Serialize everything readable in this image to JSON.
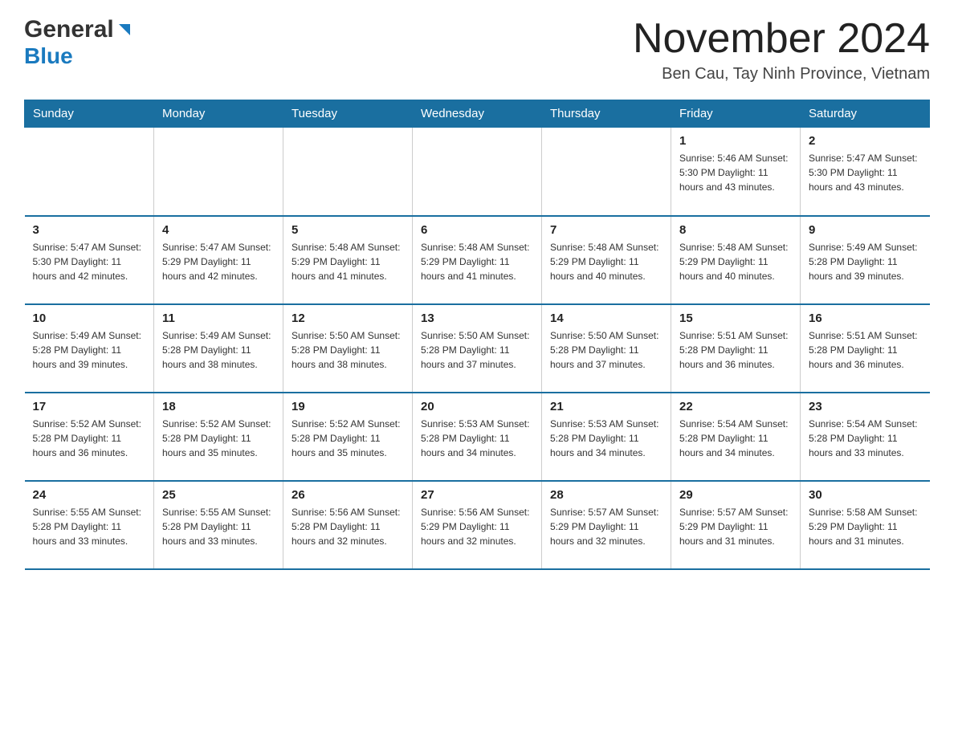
{
  "header": {
    "logo_general": "General",
    "logo_blue": "Blue",
    "month_title": "November 2024",
    "location": "Ben Cau, Tay Ninh Province, Vietnam"
  },
  "weekdays": [
    "Sunday",
    "Monday",
    "Tuesday",
    "Wednesday",
    "Thursday",
    "Friday",
    "Saturday"
  ],
  "weeks": [
    [
      {
        "day": "",
        "info": ""
      },
      {
        "day": "",
        "info": ""
      },
      {
        "day": "",
        "info": ""
      },
      {
        "day": "",
        "info": ""
      },
      {
        "day": "",
        "info": ""
      },
      {
        "day": "1",
        "info": "Sunrise: 5:46 AM\nSunset: 5:30 PM\nDaylight: 11 hours and 43 minutes."
      },
      {
        "day": "2",
        "info": "Sunrise: 5:47 AM\nSunset: 5:30 PM\nDaylight: 11 hours and 43 minutes."
      }
    ],
    [
      {
        "day": "3",
        "info": "Sunrise: 5:47 AM\nSunset: 5:30 PM\nDaylight: 11 hours and 42 minutes."
      },
      {
        "day": "4",
        "info": "Sunrise: 5:47 AM\nSunset: 5:29 PM\nDaylight: 11 hours and 42 minutes."
      },
      {
        "day": "5",
        "info": "Sunrise: 5:48 AM\nSunset: 5:29 PM\nDaylight: 11 hours and 41 minutes."
      },
      {
        "day": "6",
        "info": "Sunrise: 5:48 AM\nSunset: 5:29 PM\nDaylight: 11 hours and 41 minutes."
      },
      {
        "day": "7",
        "info": "Sunrise: 5:48 AM\nSunset: 5:29 PM\nDaylight: 11 hours and 40 minutes."
      },
      {
        "day": "8",
        "info": "Sunrise: 5:48 AM\nSunset: 5:29 PM\nDaylight: 11 hours and 40 minutes."
      },
      {
        "day": "9",
        "info": "Sunrise: 5:49 AM\nSunset: 5:28 PM\nDaylight: 11 hours and 39 minutes."
      }
    ],
    [
      {
        "day": "10",
        "info": "Sunrise: 5:49 AM\nSunset: 5:28 PM\nDaylight: 11 hours and 39 minutes."
      },
      {
        "day": "11",
        "info": "Sunrise: 5:49 AM\nSunset: 5:28 PM\nDaylight: 11 hours and 38 minutes."
      },
      {
        "day": "12",
        "info": "Sunrise: 5:50 AM\nSunset: 5:28 PM\nDaylight: 11 hours and 38 minutes."
      },
      {
        "day": "13",
        "info": "Sunrise: 5:50 AM\nSunset: 5:28 PM\nDaylight: 11 hours and 37 minutes."
      },
      {
        "day": "14",
        "info": "Sunrise: 5:50 AM\nSunset: 5:28 PM\nDaylight: 11 hours and 37 minutes."
      },
      {
        "day": "15",
        "info": "Sunrise: 5:51 AM\nSunset: 5:28 PM\nDaylight: 11 hours and 36 minutes."
      },
      {
        "day": "16",
        "info": "Sunrise: 5:51 AM\nSunset: 5:28 PM\nDaylight: 11 hours and 36 minutes."
      }
    ],
    [
      {
        "day": "17",
        "info": "Sunrise: 5:52 AM\nSunset: 5:28 PM\nDaylight: 11 hours and 36 minutes."
      },
      {
        "day": "18",
        "info": "Sunrise: 5:52 AM\nSunset: 5:28 PM\nDaylight: 11 hours and 35 minutes."
      },
      {
        "day": "19",
        "info": "Sunrise: 5:52 AM\nSunset: 5:28 PM\nDaylight: 11 hours and 35 minutes."
      },
      {
        "day": "20",
        "info": "Sunrise: 5:53 AM\nSunset: 5:28 PM\nDaylight: 11 hours and 34 minutes."
      },
      {
        "day": "21",
        "info": "Sunrise: 5:53 AM\nSunset: 5:28 PM\nDaylight: 11 hours and 34 minutes."
      },
      {
        "day": "22",
        "info": "Sunrise: 5:54 AM\nSunset: 5:28 PM\nDaylight: 11 hours and 34 minutes."
      },
      {
        "day": "23",
        "info": "Sunrise: 5:54 AM\nSunset: 5:28 PM\nDaylight: 11 hours and 33 minutes."
      }
    ],
    [
      {
        "day": "24",
        "info": "Sunrise: 5:55 AM\nSunset: 5:28 PM\nDaylight: 11 hours and 33 minutes."
      },
      {
        "day": "25",
        "info": "Sunrise: 5:55 AM\nSunset: 5:28 PM\nDaylight: 11 hours and 33 minutes."
      },
      {
        "day": "26",
        "info": "Sunrise: 5:56 AM\nSunset: 5:28 PM\nDaylight: 11 hours and 32 minutes."
      },
      {
        "day": "27",
        "info": "Sunrise: 5:56 AM\nSunset: 5:29 PM\nDaylight: 11 hours and 32 minutes."
      },
      {
        "day": "28",
        "info": "Sunrise: 5:57 AM\nSunset: 5:29 PM\nDaylight: 11 hours and 32 minutes."
      },
      {
        "day": "29",
        "info": "Sunrise: 5:57 AM\nSunset: 5:29 PM\nDaylight: 11 hours and 31 minutes."
      },
      {
        "day": "30",
        "info": "Sunrise: 5:58 AM\nSunset: 5:29 PM\nDaylight: 11 hours and 31 minutes."
      }
    ]
  ]
}
